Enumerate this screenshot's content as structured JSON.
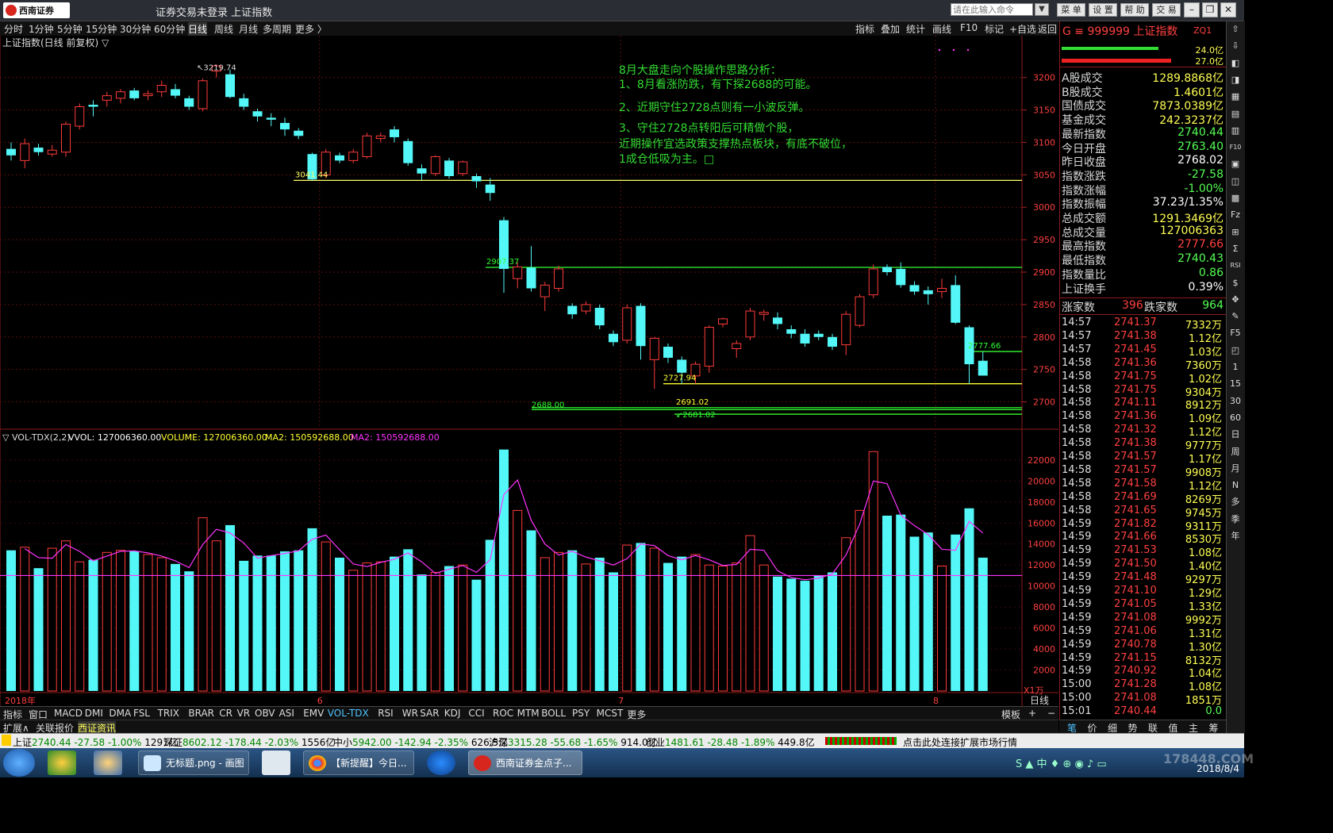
{
  "titlebar": {
    "logo_text": "西南证券",
    "title": "证券交易未登录   上证指数",
    "cmd_placeholder": "请在此输入命令",
    "buttons": [
      "菜 单",
      "设 置",
      "帮 助",
      "交 易"
    ]
  },
  "periods": [
    "分时",
    "1分钟",
    "5分钟",
    "15分钟",
    "30分钟",
    "60分钟",
    "日线",
    "周线",
    "月线",
    "多周期",
    "更多 〉"
  ],
  "active_period": "日线",
  "toolbar_right": [
    "指标",
    "叠加",
    "统计",
    "画线",
    "F10",
    "标记",
    "+自选",
    "返回"
  ],
  "chart": {
    "main_label": "上证指数(日线 前复权) ▽",
    "vol_legend": {
      "name": "▽ VOL-TDX(2,2)",
      "vvol": "VVOL: 127006360.00",
      "volume": "VOLUME: 127006360.00",
      "ma2a": "MA2: 150592688.00",
      "ma2b": "MA2: 150592688.00"
    },
    "vol_unit": "X1万",
    "annotation": [
      "8月大盘走向个股操作思路分析：",
      "1、8月看涨防跌，有下探2688的可能。",
      "2、近期守住2728点则有一小波反弹。",
      "3、守住2728点转阳后可精做个股，",
      "近期操作宜选政策支撑热点板块，有底不破位，",
      "1成仓低吸为主。□"
    ],
    "price_labels": {
      "high": "3219.74",
      "p3041": "3041.44",
      "p2907": "2907.37",
      "p2777": "2777.66",
      "p2727": "2727.94",
      "p2691": "2691.02",
      "p2681": "2681.02",
      "p2688": "2688.00"
    },
    "x_labels": [
      "2018年",
      "6",
      "7",
      "8"
    ],
    "x_period": "日线"
  },
  "chart_data": {
    "type": "candlestick",
    "title": "上证指数(日线 前复权)",
    "y_ticks": [
      3200,
      3150,
      3100,
      3050,
      3000,
      2950,
      2900,
      2850,
      2800,
      2750,
      2700
    ],
    "ylim": [
      2675,
      3240
    ],
    "vol_y_ticks": [
      22000,
      20000,
      18000,
      16000,
      14000,
      12000,
      10000,
      8000,
      6000,
      4000,
      2000
    ],
    "vol_ylim": [
      0,
      23500
    ],
    "x_labels": [
      {
        "label": "2018年",
        "index": 0
      },
      {
        "label": "6",
        "index": 23
      },
      {
        "label": "7",
        "index": 45
      },
      {
        "label": "8",
        "index": 68
      }
    ],
    "hlines": [
      {
        "value": 3041.44,
        "color": "#ffff66"
      },
      {
        "value": 2907.37,
        "color": "#33ff33"
      },
      {
        "value": 2777.66,
        "color": "#33ff33"
      },
      {
        "value": 2727.94,
        "color": "#ffff33"
      },
      {
        "value": 2691.02,
        "color": "#33ff33"
      },
      {
        "value": 2681.02,
        "color": "#33ff33"
      },
      {
        "value": 2688.0,
        "color": "#33ff33"
      }
    ],
    "vol_mline": 11000,
    "candles": [
      {
        "o": 3090,
        "c": 3080,
        "h": 3100,
        "l": 3072,
        "v": 13400
      },
      {
        "o": 3072,
        "c": 3098,
        "h": 3106,
        "l": 3060,
        "v": 13700
      },
      {
        "o": 3092,
        "c": 3085,
        "h": 3098,
        "l": 3080,
        "v": 11700
      },
      {
        "o": 3082,
        "c": 3088,
        "h": 3096,
        "l": 3078,
        "v": 13600
      },
      {
        "o": 3085,
        "c": 3128,
        "h": 3132,
        "l": 3078,
        "v": 14300
      },
      {
        "o": 3125,
        "c": 3155,
        "h": 3160,
        "l": 3120,
        "v": 12300
      },
      {
        "o": 3158,
        "c": 3155,
        "h": 3165,
        "l": 3140,
        "v": 12500
      },
      {
        "o": 3165,
        "c": 3172,
        "h": 3178,
        "l": 3155,
        "v": 13200
      },
      {
        "o": 3168,
        "c": 3178,
        "h": 3182,
        "l": 3160,
        "v": 13400
      },
      {
        "o": 3180,
        "c": 3168,
        "h": 3184,
        "l": 3165,
        "v": 13300
      },
      {
        "o": 3172,
        "c": 3175,
        "h": 3180,
        "l": 3165,
        "v": 13000
      },
      {
        "o": 3178,
        "c": 3188,
        "h": 3195,
        "l": 3170,
        "v": 12700
      },
      {
        "o": 3182,
        "c": 3172,
        "h": 3190,
        "l": 3168,
        "v": 12100
      },
      {
        "o": 3168,
        "c": 3155,
        "h": 3172,
        "l": 3150,
        "v": 11400
      },
      {
        "o": 3152,
        "c": 3195,
        "h": 3198,
        "l": 3148,
        "v": 16500
      },
      {
        "o": 3210,
        "c": 3218,
        "h": 3219.74,
        "l": 3200,
        "v": 14300
      },
      {
        "o": 3205,
        "c": 3170,
        "h": 3212,
        "l": 3168,
        "v": 15800
      },
      {
        "o": 3168,
        "c": 3155,
        "h": 3175,
        "l": 3150,
        "v": 12400
      },
      {
        "o": 3148,
        "c": 3140,
        "h": 3152,
        "l": 3132,
        "v": 12900
      },
      {
        "o": 3138,
        "c": 3135,
        "h": 3145,
        "l": 3125,
        "v": 12900
      },
      {
        "o": 3130,
        "c": 3120,
        "h": 3138,
        "l": 3110,
        "v": 13300
      },
      {
        "o": 3118,
        "c": 3110,
        "h": 3122,
        "l": 3105,
        "v": 13400
      },
      {
        "o": 3082,
        "c": 3043,
        "h": 3084,
        "l": 3041.44,
        "v": 15500
      },
      {
        "o": 3050,
        "c": 3085,
        "h": 3090,
        "l": 3045,
        "v": 14200
      },
      {
        "o": 3080,
        "c": 3072,
        "h": 3084,
        "l": 3068,
        "v": 12700
      },
      {
        "o": 3072,
        "c": 3085,
        "h": 3090,
        "l": 3068,
        "v": 11500
      },
      {
        "o": 3078,
        "c": 3110,
        "h": 3115,
        "l": 3075,
        "v": 12200
      },
      {
        "o": 3106,
        "c": 3110,
        "h": 3115,
        "l": 3100,
        "v": 12300
      },
      {
        "o": 3120,
        "c": 3108,
        "h": 3125,
        "l": 3100,
        "v": 12800
      },
      {
        "o": 3102,
        "c": 3068,
        "h": 3106,
        "l": 3064,
        "v": 13500
      },
      {
        "o": 3060,
        "c": 3052,
        "h": 3066,
        "l": 3042,
        "v": 11100
      },
      {
        "o": 3052,
        "c": 3078,
        "h": 3080,
        "l": 3048,
        "v": 11300
      },
      {
        "o": 3072,
        "c": 3048,
        "h": 3076,
        "l": 3044,
        "v": 11900
      },
      {
        "o": 3052,
        "c": 3070,
        "h": 3072,
        "l": 3048,
        "v": 12000
      },
      {
        "o": 3048,
        "c": 3040,
        "h": 3052,
        "l": 3030,
        "v": 10600
      },
      {
        "o": 3035,
        "c": 3022,
        "h": 3045,
        "l": 3010,
        "v": 14400
      },
      {
        "o": 2980,
        "c": 2905,
        "h": 2985,
        "l": 2868,
        "v": 23000
      },
      {
        "o": 2890,
        "c": 2908,
        "h": 2915,
        "l": 2875,
        "v": 17200
      },
      {
        "o": 2907,
        "c": 2875,
        "h": 2940,
        "l": 2870,
        "v": 15300
      },
      {
        "o": 2862,
        "c": 2880,
        "h": 2885,
        "l": 2840,
        "v": 12700
      },
      {
        "o": 2875,
        "c": 2905,
        "h": 2910,
        "l": 2870,
        "v": 13200
      },
      {
        "o": 2848,
        "c": 2835,
        "h": 2852,
        "l": 2828,
        "v": 13400
      },
      {
        "o": 2840,
        "c": 2850,
        "h": 2855,
        "l": 2835,
        "v": 12100
      },
      {
        "o": 2845,
        "c": 2818,
        "h": 2850,
        "l": 2812,
        "v": 12700
      },
      {
        "o": 2805,
        "c": 2792,
        "h": 2810,
        "l": 2786,
        "v": 11300
      },
      {
        "o": 2795,
        "c": 2845,
        "h": 2850,
        "l": 2790,
        "v": 13900
      },
      {
        "o": 2848,
        "c": 2786,
        "h": 2852,
        "l": 2765,
        "v": 14100
      },
      {
        "o": 2765,
        "c": 2798,
        "h": 2800,
        "l": 2720,
        "v": 13600
      },
      {
        "o": 2785,
        "c": 2768,
        "h": 2790,
        "l": 2760,
        "v": 12200
      },
      {
        "o": 2765,
        "c": 2745,
        "h": 2770,
        "l": 2728,
        "v": 12800
      },
      {
        "o": 2740,
        "c": 2758,
        "h": 2762,
        "l": 2727.94,
        "v": 13000
      },
      {
        "o": 2755,
        "c": 2815,
        "h": 2818,
        "l": 2745,
        "v": 12000
      },
      {
        "o": 2820,
        "c": 2828,
        "h": 2830,
        "l": 2815,
        "v": 11900
      },
      {
        "o": 2782,
        "c": 2790,
        "h": 2795,
        "l": 2768,
        "v": 12200
      },
      {
        "o": 2800,
        "c": 2840,
        "h": 2845,
        "l": 2795,
        "v": 14800
      },
      {
        "o": 2835,
        "c": 2838,
        "h": 2842,
        "l": 2825,
        "v": 12000
      },
      {
        "o": 2830,
        "c": 2820,
        "h": 2838,
        "l": 2812,
        "v": 10900
      },
      {
        "o": 2812,
        "c": 2805,
        "h": 2818,
        "l": 2798,
        "v": 10700
      },
      {
        "o": 2805,
        "c": 2790,
        "h": 2812,
        "l": 2785,
        "v": 10500
      },
      {
        "o": 2805,
        "c": 2800,
        "h": 2810,
        "l": 2795,
        "v": 11000
      },
      {
        "o": 2800,
        "c": 2785,
        "h": 2805,
        "l": 2780,
        "v": 11300
      },
      {
        "o": 2788,
        "c": 2835,
        "h": 2840,
        "l": 2772,
        "v": 14600
      },
      {
        "o": 2818,
        "c": 2862,
        "h": 2866,
        "l": 2815,
        "v": 17200
      },
      {
        "o": 2865,
        "c": 2905,
        "h": 2912,
        "l": 2860,
        "v": 22800
      },
      {
        "o": 2908,
        "c": 2900,
        "h": 2912,
        "l": 2895,
        "v": 16700
      },
      {
        "o": 2905,
        "c": 2880,
        "h": 2915,
        "l": 2876,
        "v": 16800
      },
      {
        "o": 2880,
        "c": 2870,
        "h": 2886,
        "l": 2865,
        "v": 14700
      },
      {
        "o": 2872,
        "c": 2866,
        "h": 2878,
        "l": 2850,
        "v": 15100
      },
      {
        "o": 2870,
        "c": 2875,
        "h": 2890,
        "l": 2860,
        "v": 11900
      },
      {
        "o": 2880,
        "c": 2822,
        "h": 2895,
        "l": 2820,
        "v": 14900
      },
      {
        "o": 2815,
        "c": 2758,
        "h": 2818,
        "l": 2727.94,
        "v": 17400
      },
      {
        "o": 2763.4,
        "c": 2740.44,
        "h": 2777.66,
        "l": 2740.43,
        "v": 12700
      }
    ]
  },
  "rpanel": {
    "code": "G ≡ 999999 上证指数",
    "tag": "ZQ1",
    "bar_top": "24.0亿",
    "bar_bot": "27.0亿",
    "stats": [
      {
        "k": "A股成交",
        "v": "1289.8868亿",
        "c": "#ffff55"
      },
      {
        "k": "B股成交",
        "v": "1.4601亿",
        "c": "#ffff55"
      },
      {
        "k": "国债成交",
        "v": "7873.0389亿",
        "c": "#ffff55"
      },
      {
        "k": "基金成交",
        "v": "242.3237亿",
        "c": "#ffff55"
      },
      {
        "k": "最新指数",
        "v": "2740.44",
        "c": "#55ff55"
      },
      {
        "k": "今日开盘",
        "v": "2763.40",
        "c": "#55ff55"
      },
      {
        "k": "昨日收盘",
        "v": "2768.02",
        "c": "#ffffff"
      },
      {
        "k": "指数涨跌",
        "v": "-27.58",
        "c": "#55ff55"
      },
      {
        "k": "指数涨幅",
        "v": "-1.00%",
        "c": "#55ff55"
      },
      {
        "k": "指数振幅",
        "v": "37.23/1.35%",
        "c": "#ffffff"
      },
      {
        "k": "总成交额",
        "v": "1291.3469亿",
        "c": "#ffff55"
      },
      {
        "k": "总成交量",
        "v": "127006363",
        "c": "#ffff55"
      },
      {
        "k": "最高指数",
        "v": "2777.66",
        "c": "#ff4040"
      },
      {
        "k": "最低指数",
        "v": "2740.43",
        "c": "#55ff55"
      },
      {
        "k": "指数量比",
        "v": "0.86",
        "c": "#55ff55"
      },
      {
        "k": "上证换手",
        "v": "0.39%",
        "c": "#ffffff"
      }
    ],
    "rise_label": "涨家数",
    "rise": "396",
    "fall_label": "跌家数",
    "fall": "964",
    "ticks": [
      [
        "14:57",
        "2741.37",
        "7332万"
      ],
      [
        "14:57",
        "2741.38",
        "1.12亿"
      ],
      [
        "14:57",
        "2741.45",
        "1.03亿"
      ],
      [
        "14:58",
        "2741.36",
        "7360万"
      ],
      [
        "14:58",
        "2741.75",
        "1.02亿"
      ],
      [
        "14:58",
        "2741.75",
        "9304万"
      ],
      [
        "14:58",
        "2741.11",
        "8912万"
      ],
      [
        "14:58",
        "2741.36",
        "1.09亿"
      ],
      [
        "14:58",
        "2741.32",
        "1.12亿"
      ],
      [
        "14:58",
        "2741.38",
        "9777万"
      ],
      [
        "14:58",
        "2741.57",
        "1.17亿"
      ],
      [
        "14:58",
        "2741.57",
        "9908万"
      ],
      [
        "14:58",
        "2741.58",
        "1.12亿"
      ],
      [
        "14:58",
        "2741.69",
        "8269万"
      ],
      [
        "14:58",
        "2741.65",
        "9745万"
      ],
      [
        "14:59",
        "2741.82",
        "9311万"
      ],
      [
        "14:59",
        "2741.66",
        "8530万"
      ],
      [
        "14:59",
        "2741.53",
        "1.08亿"
      ],
      [
        "14:59",
        "2741.50",
        "1.40亿"
      ],
      [
        "14:59",
        "2741.48",
        "9297万"
      ],
      [
        "14:59",
        "2741.10",
        "1.29亿"
      ],
      [
        "14:59",
        "2741.05",
        "1.33亿"
      ],
      [
        "14:59",
        "2741.08",
        "9992万"
      ],
      [
        "14:59",
        "2741.06",
        "1.31亿"
      ],
      [
        "14:59",
        "2740.78",
        "1.30亿"
      ],
      [
        "14:59",
        "2741.15",
        "8132万"
      ],
      [
        "14:59",
        "2740.92",
        "1.04亿"
      ],
      [
        "15:00",
        "2741.28",
        "1.08亿"
      ],
      [
        "15:00",
        "2741.08",
        "1851万"
      ],
      [
        "15:01",
        "2740.44",
        "0.0"
      ]
    ],
    "bottom_tabs": [
      "笔",
      "价",
      "细",
      "势",
      "联",
      "值",
      "主",
      "筹"
    ]
  },
  "side_icons": [
    "⇧",
    "⇩",
    "◧",
    "◨",
    "▦",
    "▤",
    "▥",
    "F10",
    "▣",
    "◫",
    "▩",
    "Fz",
    "⊞",
    "Σ",
    "RSI",
    "$",
    "✥",
    "✎",
    "F5",
    "◰",
    "1",
    "15",
    "30",
    "60",
    "日",
    "周",
    "月",
    "N",
    "多",
    "季",
    "年"
  ],
  "tabs1": [
    "指标",
    "窗口",
    "MACD",
    "DMI",
    "DMA",
    "FSL",
    "TRIX",
    "BRAR",
    "CR",
    "VR",
    "OBV",
    "ASI",
    "EMV",
    "VOL-TDX",
    "RSI",
    "WR",
    "SAR",
    "KDJ",
    "CCI",
    "ROC",
    "MTM",
    "BOLL",
    "PSY",
    "MCST",
    "更多"
  ],
  "tabs1_active": "VOL-TDX",
  "tabs1_right": [
    "模板",
    "+",
    "−"
  ],
  "tabs2": [
    "扩展∧",
    "关联报价",
    "西证资讯"
  ],
  "status": [
    {
      "n": "上证",
      "v": "2740.44",
      "d": "-27.58",
      "p": "-1.00%",
      "a": "1291亿"
    },
    {
      "n": "深证",
      "v": "8602.12",
      "d": "-178.44",
      "p": "-2.03%",
      "a": "1556亿"
    },
    {
      "n": "中小",
      "v": "5942.00",
      "d": "-142.94",
      "p": "-2.35%",
      "a": "626.5亿"
    },
    {
      "n": "沪深",
      "v": "3315.28",
      "d": "-55.68",
      "p": "-1.65%",
      "a": "914.0亿"
    },
    {
      "n": "创业",
      "v": "1481.61",
      "d": "-28.48",
      "p": "-1.89%",
      "a": "449.8亿"
    }
  ],
  "status_link": "点击此处连接扩展市场行情",
  "taskbar": {
    "items": [
      "无标题.png - 画图",
      "【新提醒】今日...",
      "西南证券金点子..."
    ],
    "tray_watermark": "178448.COM",
    "date": "2018/8/4"
  }
}
